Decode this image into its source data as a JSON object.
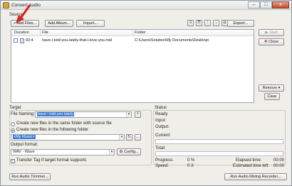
{
  "window": {
    "title": "Convert Audio",
    "minimize": "–",
    "maximize": "□",
    "close": "x"
  },
  "source": {
    "label": "Source",
    "add_files": "Add Files...",
    "add_album": "Add Album...",
    "import": "Import...",
    "export": "Export...",
    "start": "Start",
    "close": "Close",
    "remove": "Remove",
    "clear": "Clear",
    "columns": [
      "Duration",
      "File",
      "Folder"
    ],
    "rows": [
      {
        "checked": false,
        "duration": "03:4",
        "file": "have-i-told-you-lately-that-i-love-you.mid",
        "folder": "C:\\Users\\Solution\\My Documents\\Desktop\\"
      }
    ]
  },
  "target": {
    "label": "Target",
    "file_naming_label": "File Naming:",
    "file_naming_value": "have i told you lately",
    "radio_same_folder": "Create new files in the same folder with source file",
    "radio_following_folder": "Create new files in the following folder",
    "radio_selected": "following",
    "folder_value": "<My Music>",
    "output_format_label": "Output format:",
    "output_format_value": "WAV - Wave",
    "config_button": "Config...",
    "transfer_tag_label": "Transfer Tag if target format supports",
    "transfer_tag_checked": true,
    "trimmer_button": "Run Audio Trimmer..."
  },
  "status": {
    "label": "Status",
    "state": "Ready",
    "input_label": "Input:",
    "output_label": "Output:",
    "current_label": "Current:",
    "total_label": "Total:",
    "progress_label": "Progress:",
    "progress_value": "0 %",
    "speed_label": "Speed:",
    "speed_value": "0 X",
    "elapsed_label": "Elapsed time:",
    "elapsed_value": "00:00",
    "remaining_label": "Estimated time left:",
    "remaining_value": "00:00",
    "current_progress": 0,
    "total_progress": 0,
    "recorder_button": "Run Audio Mixing Recorder..."
  },
  "colors": {
    "annotation_arrow": "#d0261e",
    "selection": "#3a7bd5"
  }
}
